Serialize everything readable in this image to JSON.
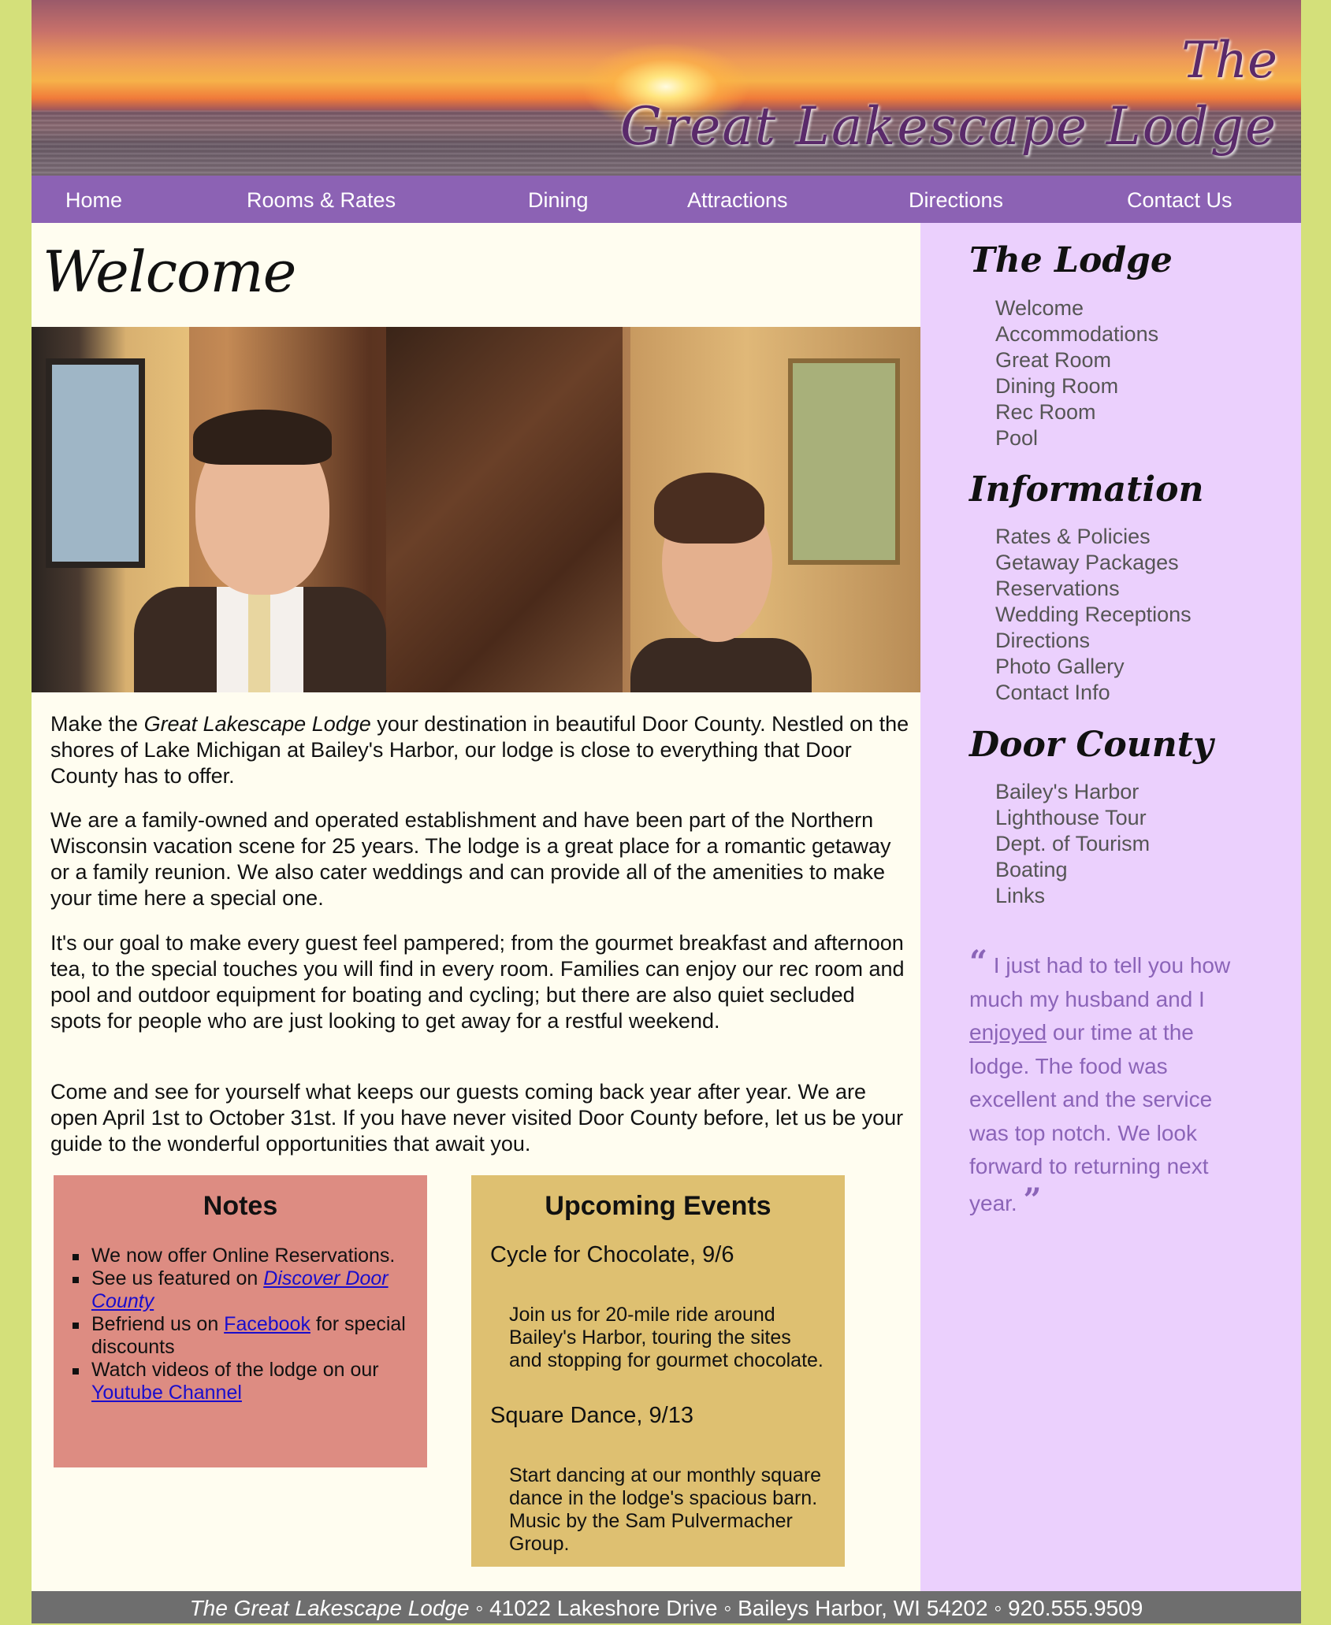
{
  "banner": {
    "logo_line1": "The",
    "logo_line2": "Great Lakescape Lodge"
  },
  "nav": {
    "items": [
      "Home",
      "Rooms & Rates",
      "Dining",
      "Attractions",
      "Directions",
      "Contact Us"
    ]
  },
  "main": {
    "heading": "Welcome",
    "intro_p1_before": "Make the ",
    "intro_p1_em": "Great Lakescape Lodge",
    "intro_p1_after": " your destination in beautiful Door County. Nestled on the shores of Lake Michigan at Bailey's Harbor, our lodge is close to everything that Door County has to offer.",
    "intro_p2": "We are a family-owned and operated establishment and have been part of the Northern Wisconsin vacation scene for 25 years. The lodge is a great place for a romantic getaway or a family reunion. We also cater weddings and can provide all of the amenities to make your time here a special one.",
    "intro_p3": "It's our goal to make every guest feel pampered; from the gourmet breakfast and afternoon tea, to the special touches you will find in every room. Families can enjoy our rec room and pool and outdoor equipment for boating and cycling; but there are also quiet secluded spots for people who are just looking to get away for a restful weekend.",
    "intro_p4": "Come and see for yourself what keeps our guests coming back year after year. We are open April 1st to October 31st. If you have never visited Door County before, let us be your guide to the wonderful opportunities that await you."
  },
  "notes": {
    "title": "Notes",
    "item1": "We now offer Online Reservations.",
    "item2_before": "See us featured on ",
    "item2_link": "Discover Door County",
    "item3_before": "Befriend us on ",
    "item3_link": "Facebook",
    "item3_after": " for special discounts",
    "item4_before": "Watch videos of the lodge on our ",
    "item4_link": "Youtube Channel"
  },
  "events": {
    "title": "Upcoming Events",
    "items": [
      {
        "title": "Cycle for Chocolate, 9/6",
        "desc": "Join us for 20-mile ride around Bailey's Harbor, touring the sites and stopping for gourmet chocolate."
      },
      {
        "title": "Square Dance, 9/13",
        "desc": "Start dancing at our monthly square dance in the lodge's spacious barn. Music by the Sam Pulvermacher Group."
      }
    ]
  },
  "sidebar": {
    "lodge_heading": "The Lodge",
    "lodge_items": [
      "Welcome",
      "Accommodations",
      "Great Room",
      "Dining Room",
      "Rec Room",
      "Pool"
    ],
    "info_heading": "Information",
    "info_items": [
      "Rates & Policies",
      "Getaway Packages",
      "Reservations",
      "Wedding Receptions",
      "Directions",
      "Photo Gallery",
      "Contact Info"
    ],
    "county_heading": "Door County",
    "county_items": [
      "Bailey's Harbor",
      "Lighthouse Tour",
      "Dept. of Tourism",
      "Boating",
      "Links"
    ],
    "quote_open": "“",
    "quote_before": " I just had to tell you how much my husband and I ",
    "quote_link": "enjoyed",
    "quote_after": " our time at the lodge. The food was excellent and the service was top notch. We look forward to returning next year. ",
    "quote_close": "”"
  },
  "footer": {
    "name": "The Great Lakescape Lodge",
    "address": " ◦ 41022 Lakeshore Drive ◦ Baileys Harbor, WI 54202 ◦ 920.555.9509"
  },
  "colors": {
    "outer_background": "#d4e07a",
    "nav_purple": "#8c62b4",
    "sidebar_lavender": "#ebd0fd",
    "notes_box": "#dd8c82",
    "events_box": "#dec071",
    "footer_gray": "#6e6e6e"
  }
}
